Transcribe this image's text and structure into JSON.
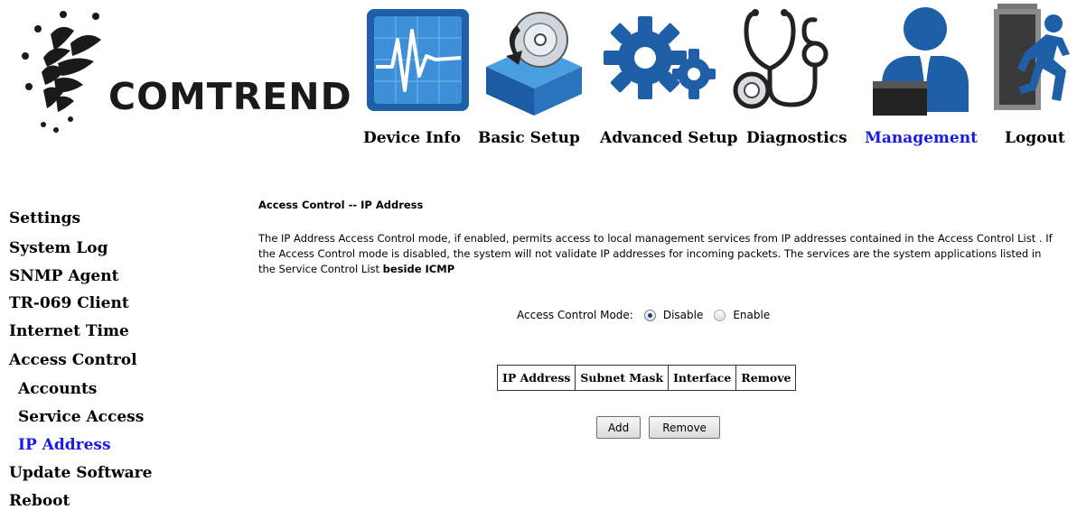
{
  "brand": {
    "name": "COMTREND",
    "color": "#1a1a1a"
  },
  "nav": [
    {
      "label": "Device Info",
      "icon": "device-info-icon",
      "active": false
    },
    {
      "label": "Basic Setup",
      "icon": "basic-setup-icon",
      "active": false
    },
    {
      "label": "Advanced Setup",
      "icon": "advanced-setup-icon",
      "active": false
    },
    {
      "label": "Diagnostics",
      "icon": "diagnostics-icon",
      "active": false
    },
    {
      "label": "Management",
      "icon": "management-icon",
      "active": true
    },
    {
      "label": "Logout",
      "icon": "logout-icon",
      "active": false
    }
  ],
  "sidebar": {
    "items": [
      {
        "label": "Settings"
      },
      {
        "label": "System Log"
      },
      {
        "label": "SNMP Agent"
      },
      {
        "label": "TR-069 Client"
      },
      {
        "label": "Internet Time"
      },
      {
        "label": "Access Control"
      },
      {
        "label": "Accounts"
      },
      {
        "label": "Service Access"
      },
      {
        "label": "IP Address",
        "active": true
      },
      {
        "label": "Update Software"
      },
      {
        "label": "Reboot"
      }
    ]
  },
  "content": {
    "title": "Access Control -- IP Address",
    "description": "The IP Address Access Control mode, if enabled, permits access to local management services from IP addresses contained in the Access Control List . If the Access Control mode is disabled, the system will not validate IP addresses for incoming packets. The services are the system applications listed in the Service Control List ",
    "description_bold": "beside ICMP",
    "mode_label": "Access Control Mode:",
    "mode_options": [
      "Disable",
      "Enable"
    ],
    "mode_selected": "Disable",
    "table_headers": [
      "IP Address",
      "Subnet Mask",
      "Interface",
      "Remove"
    ],
    "add_button": "Add",
    "remove_button": "Remove"
  },
  "colors": {
    "active_link": "#1a1ae6",
    "icon_blue": "#1e5fa8",
    "icon_dark": "#222222"
  }
}
